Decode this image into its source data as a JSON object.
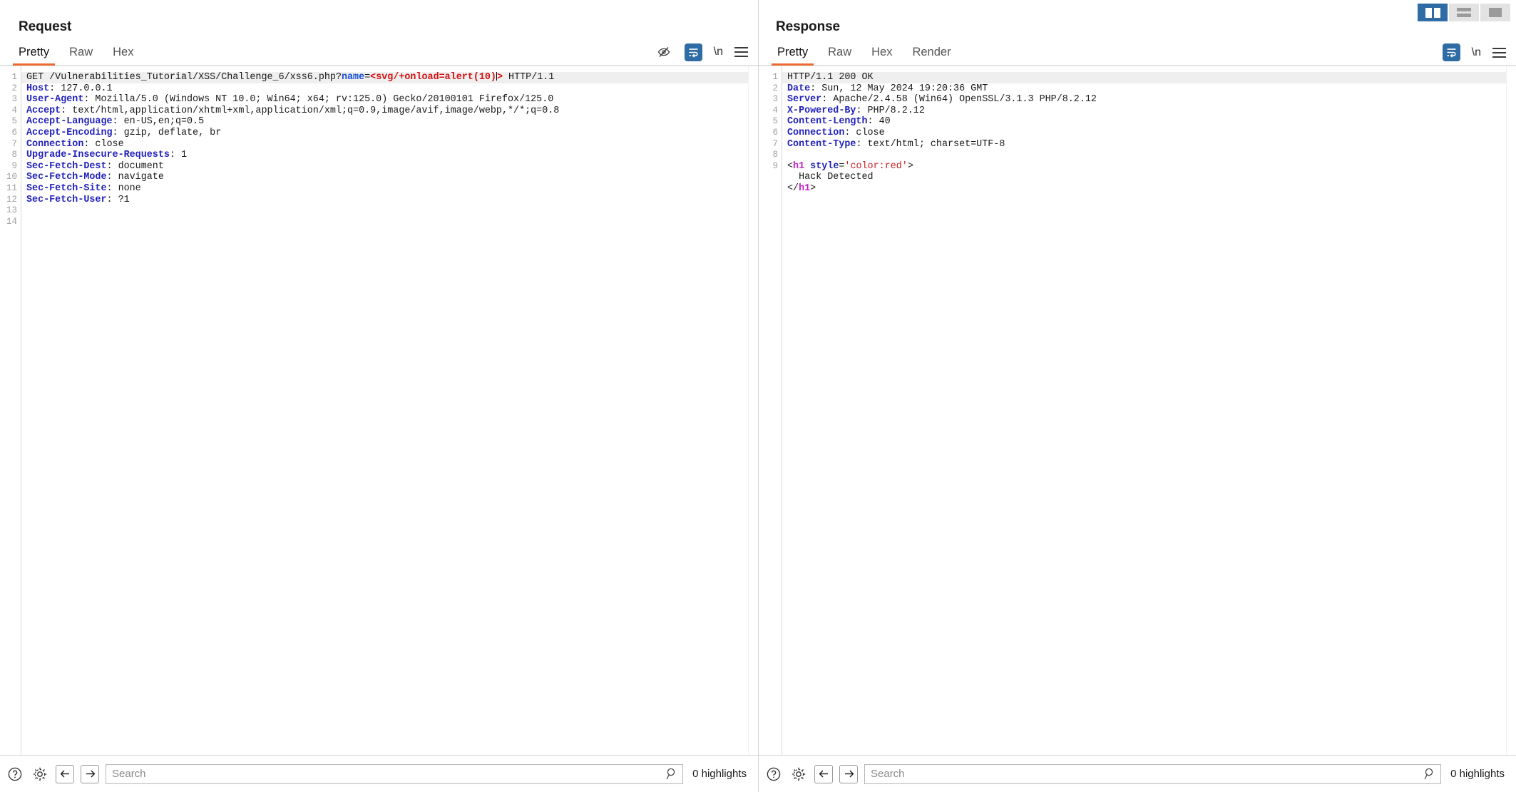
{
  "layout_toggle": {
    "buttons": [
      {
        "name": "vertical-split",
        "selected": true
      },
      {
        "name": "horizontal-split",
        "selected": false
      },
      {
        "name": "single-pane",
        "selected": false
      }
    ]
  },
  "request": {
    "title": "Request",
    "tabs": [
      {
        "label": "Pretty",
        "active": true
      },
      {
        "label": "Raw",
        "active": false
      },
      {
        "label": "Hex",
        "active": false
      }
    ],
    "tools": [
      {
        "name": "hide-icon",
        "label": ""
      },
      {
        "name": "word-wrap-icon",
        "label": ""
      },
      {
        "name": "newline-toggle",
        "label": "\\n"
      },
      {
        "name": "menu-icon",
        "label": ""
      }
    ],
    "lines": [
      {
        "n": 1,
        "current": true,
        "text": "GET /Vulnerabilities_Tutorial/XSS/Challenge_6/xss6.php?name=<svg/+onload=alert(10)> HTTP/1.1"
      },
      {
        "n": 2,
        "current": false,
        "text": "Host: 127.0.0.1"
      },
      {
        "n": 3,
        "current": false,
        "text": "User-Agent: Mozilla/5.0 (Windows NT 10.0; Win64; x64; rv:125.0) Gecko/20100101 Firefox/125.0"
      },
      {
        "n": 4,
        "current": false,
        "text": "Accept: text/html,application/xhtml+xml,application/xml;q=0.9,image/avif,image/webp,*/*;q=0.8"
      },
      {
        "n": 5,
        "current": false,
        "text": "Accept-Language: en-US,en;q=0.5"
      },
      {
        "n": 6,
        "current": false,
        "text": "Accept-Encoding: gzip, deflate, br"
      },
      {
        "n": 7,
        "current": false,
        "text": "Connection: close"
      },
      {
        "n": 8,
        "current": false,
        "text": "Upgrade-Insecure-Requests: 1"
      },
      {
        "n": 9,
        "current": false,
        "text": "Sec-Fetch-Dest: document"
      },
      {
        "n": 10,
        "current": false,
        "text": "Sec-Fetch-Mode: navigate"
      },
      {
        "n": 11,
        "current": false,
        "text": "Sec-Fetch-Site: none"
      },
      {
        "n": 12,
        "current": false,
        "text": "Sec-Fetch-User: ?1"
      },
      {
        "n": 13,
        "current": false,
        "text": ""
      },
      {
        "n": 14,
        "current": false,
        "text": ""
      }
    ],
    "search": {
      "placeholder": "Search",
      "value": "",
      "highlights": "0 highlights"
    }
  },
  "response": {
    "title": "Response",
    "tabs": [
      {
        "label": "Pretty",
        "active": true
      },
      {
        "label": "Raw",
        "active": false
      },
      {
        "label": "Hex",
        "active": false
      },
      {
        "label": "Render",
        "active": false
      }
    ],
    "tools": [
      {
        "name": "word-wrap-icon",
        "label": ""
      },
      {
        "name": "newline-toggle",
        "label": "\\n"
      },
      {
        "name": "menu-icon",
        "label": ""
      }
    ],
    "lines": [
      {
        "n": 1,
        "current": true,
        "text": "HTTP/1.1 200 OK"
      },
      {
        "n": 2,
        "current": false,
        "text": "Date: Sun, 12 May 2024 19:20:36 GMT"
      },
      {
        "n": 3,
        "current": false,
        "text": "Server: Apache/2.4.58 (Win64) OpenSSL/3.1.3 PHP/8.2.12"
      },
      {
        "n": 4,
        "current": false,
        "text": "X-Powered-By: PHP/8.2.12"
      },
      {
        "n": 5,
        "current": false,
        "text": "Content-Length: 40"
      },
      {
        "n": 6,
        "current": false,
        "text": "Connection: close"
      },
      {
        "n": 7,
        "current": false,
        "text": "Content-Type: text/html; charset=UTF-8"
      },
      {
        "n": 8,
        "current": false,
        "text": ""
      },
      {
        "n": 9,
        "current": false,
        "text": "<h1 style='color:red'>"
      },
      {
        "n": "",
        "current": false,
        "text": "  Hack Detected"
      },
      {
        "n": "",
        "current": false,
        "text": "</h1>"
      }
    ],
    "search": {
      "placeholder": "Search",
      "value": "",
      "highlights": "0 highlights"
    }
  }
}
